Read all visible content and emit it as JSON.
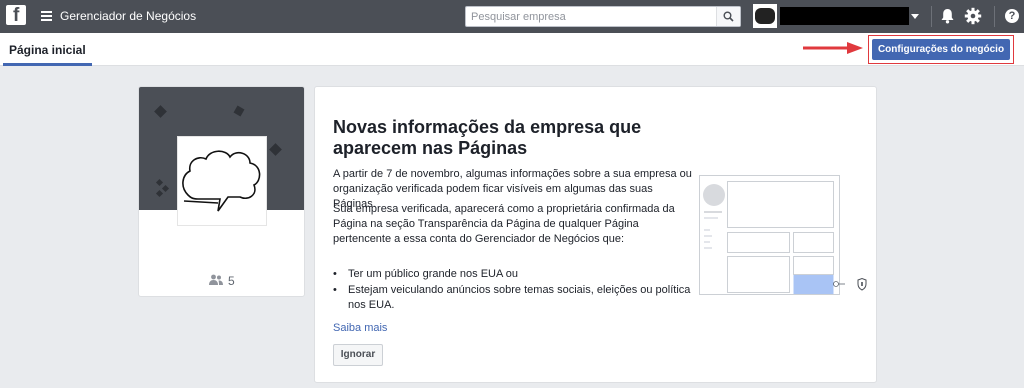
{
  "topbar": {
    "logo_letter": "f",
    "app_title": "Gerenciador de Negócios",
    "search_placeholder": "Pesquisar empresa",
    "help_glyph": "?"
  },
  "icons": {
    "logo": "facebook-logo-icon",
    "menu": "hamburger-menu-icon",
    "search": "search-icon",
    "caret": "caret-down-icon",
    "notifications": "bell-icon",
    "settings": "gear-icon",
    "help": "help-icon",
    "people": "people-icon",
    "shield": "shield-icon",
    "arrow": "red-arrow-icon"
  },
  "subheader": {
    "tab_home": "Página inicial",
    "settings_button": "Configurações do negócio"
  },
  "business": {
    "people_count": "5"
  },
  "notice": {
    "title": "Novas informações da empresa que aparecem nas Páginas",
    "paragraph1": "A partir de 7 de novembro, algumas informações sobre a sua empresa ou organização verificada podem ficar visíveis em algumas das suas Páginas.",
    "paragraph2": "Sua empresa verificada, aparecerá como a proprietária confirmada da Página na seção Transparência da Página de qualquer Página pertencente a essa conta do Gerenciador de Negócios que:",
    "bullets": [
      "Ter um público grande nos EUA ou",
      "Estejam veiculando anúncios sobre temas sociais, eleições ou política nos EUA."
    ],
    "bullet_glyph": "•",
    "learn_more": "Saiba mais",
    "ignore_button": "Ignorar"
  },
  "colors": {
    "topbar": "#4b4f56",
    "accent": "#4267b2",
    "highlight_border": "#e0393e",
    "page_bg": "#e9ebee"
  }
}
